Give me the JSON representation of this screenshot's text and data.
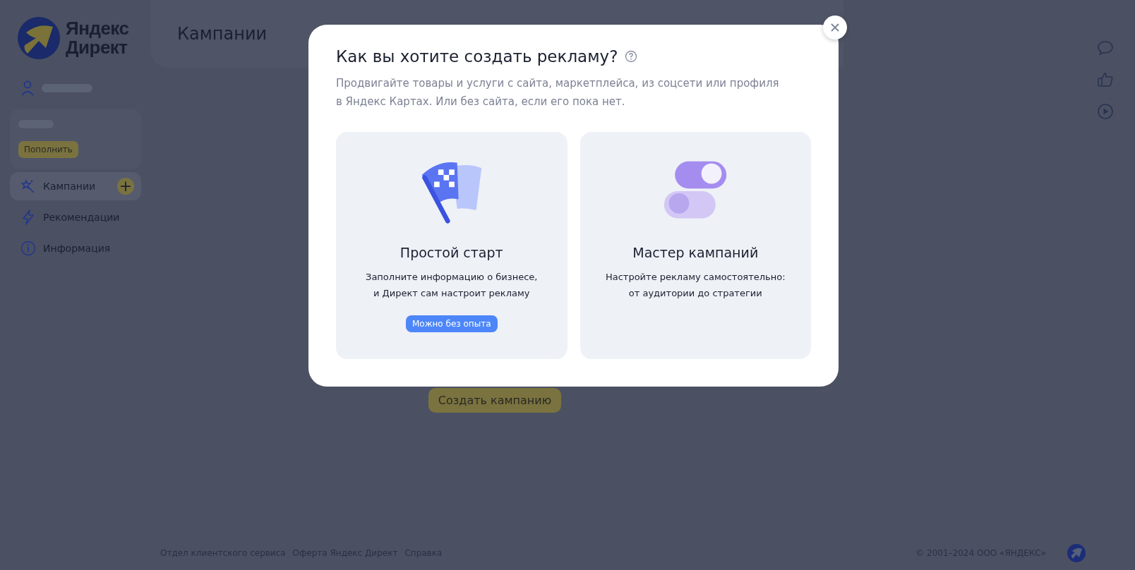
{
  "logo": {
    "line_1": "Яндекс",
    "line_2": "Директ"
  },
  "sidebar": {
    "top_up_button": "Пополнить",
    "items": [
      {
        "label": "Кампании",
        "selected": true,
        "add_button": "+"
      },
      {
        "label": "Рекомендации",
        "selected": false
      },
      {
        "label": "Информация",
        "selected": false
      }
    ]
  },
  "header": {
    "title": "Кампании"
  },
  "create_campaign_button": "Создать кампанию",
  "footer": {
    "links": [
      "Отдел клиентского сервиса",
      "Оферта Яндекс Директ",
      "Справка"
    ],
    "copyright": "© 2001–2024 ООО «ЯНДЕКС»"
  },
  "modal": {
    "title": "Как вы хотите создать рекламу?",
    "description": "Продвигайте товары и услуги с сайта, маркетплейса, из соцсети или профиля в Яндекс Картах. Или без сайта, если его пока нет.",
    "options": [
      {
        "kind": "flag",
        "title": "Простой старт",
        "text": "Заполните информацию о бизнесе,\nи Директ сам настроит рекламу",
        "badge": "Можно без опыта"
      },
      {
        "kind": "toggles",
        "title": "Мастер кампаний",
        "text": "Настройте рекламу самостоятельно:\nот аудитории до стратегии"
      }
    ]
  }
}
